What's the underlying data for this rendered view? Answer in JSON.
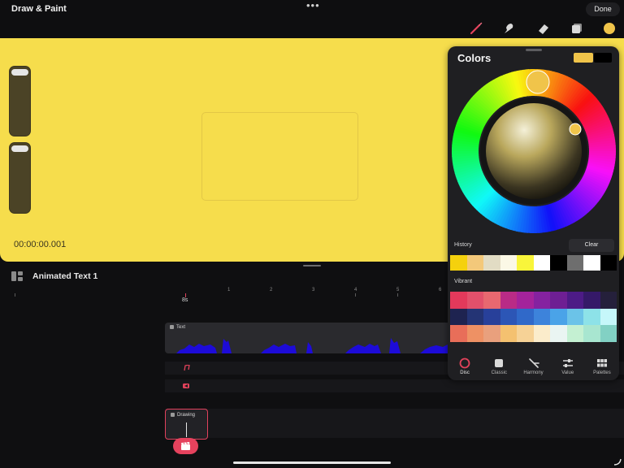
{
  "app": {
    "title": "Draw & Paint",
    "more_glyph": "•••",
    "done_label": "Done"
  },
  "toolbar": {
    "tools": [
      "brush-icon",
      "smudge-icon",
      "eraser-icon",
      "layers-icon",
      "color-icon"
    ],
    "accent": "#e3425b",
    "current_color": "#f0c44a"
  },
  "canvas": {
    "background": "#f6dd4c",
    "timecode": "00:00:00.001"
  },
  "timeline": {
    "title": "Animated Text 1",
    "ruler_ticks": [
      "1",
      "2",
      "3",
      "4",
      "5",
      "6"
    ],
    "playhead_label": "8s",
    "tracks": {
      "text_label": "Text",
      "drawing_label": "Drawing"
    }
  },
  "colors_panel": {
    "title": "Colors",
    "current_swatch": "#f0c44a",
    "previous_swatch": "#000000",
    "history_label": "History",
    "clear_label": "Clear",
    "history": [
      "#f5d10d",
      "#f3c87a",
      "#e2dcc4",
      "#fbf8e6",
      "#f9f53a",
      "#ffffff",
      "#000000",
      "#6e6e6e",
      "#ffffff",
      "#000000"
    ],
    "palette_label": "Vibrant",
    "palette": [
      "#e2395b",
      "#e2506b",
      "#e86870",
      "#b92b86",
      "#a4239b",
      "#8522a0",
      "#6e1f93",
      "#4d1b86",
      "#351968",
      "#25203b",
      "#1e2350",
      "#243475",
      "#28409a",
      "#2c56b6",
      "#3069c9",
      "#3d83db",
      "#4aa3e8",
      "#6bc3e8",
      "#8de2e8",
      "#c6f7fa",
      "#e86e59",
      "#ee9164",
      "#e9a07d",
      "#f4c170",
      "#f6d296",
      "#fbeccb",
      "#eaf5f2",
      "#c4f0d2",
      "#a8e6d0",
      "#82d1c4"
    ],
    "tabs": [
      {
        "label": "Disc",
        "icon": "disc-icon"
      },
      {
        "label": "Classic",
        "icon": "classic-icon"
      },
      {
        "label": "Harmony",
        "icon": "harmony-icon"
      },
      {
        "label": "Value",
        "icon": "value-icon"
      },
      {
        "label": "Palettes",
        "icon": "palettes-icon"
      }
    ],
    "active_tab": "Disc"
  }
}
